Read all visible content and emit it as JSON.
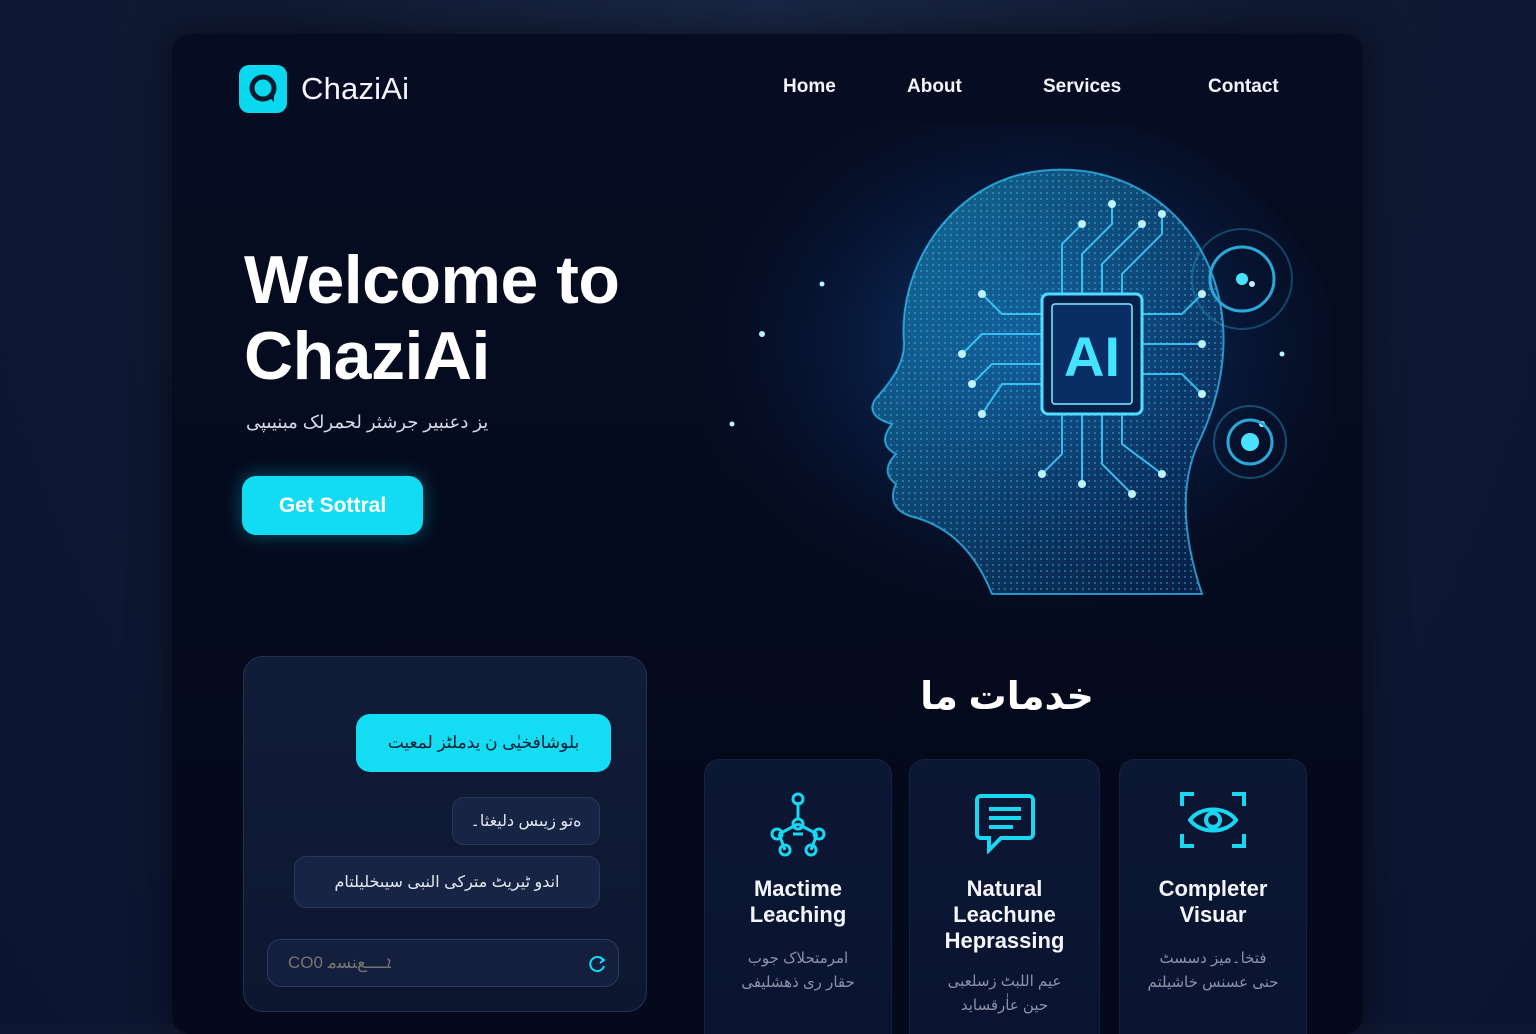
{
  "brand": {
    "name": "ChaziAi"
  },
  "nav": {
    "items": [
      "Home",
      "About",
      "Services",
      "Contact"
    ]
  },
  "hero": {
    "title_line1": "Welcome to",
    "title_line2": "ChaziAi",
    "subtitle": "یز دعنبیر جرشثر لحمرلک مبنیںپی",
    "cta_label": "Get Sottral",
    "art_text": "AI"
  },
  "chat": {
    "user_message": "بلوشافخیٰی ن یدملٹز لمعیت",
    "bot_message_1": "ەتو زیںس دلیغثا۔",
    "bot_message_2": "اندو ٹیریٹ مترکی النبی سیںخلیلتام",
    "input_placeholder": "CO0 ܐـــﻊﻨﺴﻣ"
  },
  "services": {
    "title": "خدمات ما",
    "cards": [
      {
        "icon": "network-nodes-icon",
        "title": "Mactime\nLeaching",
        "desc": "امرمتحلاک جوب\nحقار ری ذهشلیفی"
      },
      {
        "icon": "chat-bubble-icon",
        "title": "Natural\nLeachune\nHeprassing",
        "desc": "عیم اللبٹ زسلعبی\nحین عاٰرقساید"
      },
      {
        "icon": "eye-scan-icon",
        "title": "Completer\nVisuar",
        "desc": "فتخا۔میز دسسٹ\nحنی عسنس خاشیلتم"
      }
    ]
  },
  "colors": {
    "accent": "#12dcf3",
    "background": "#050b1e",
    "panel": "#111c38"
  }
}
